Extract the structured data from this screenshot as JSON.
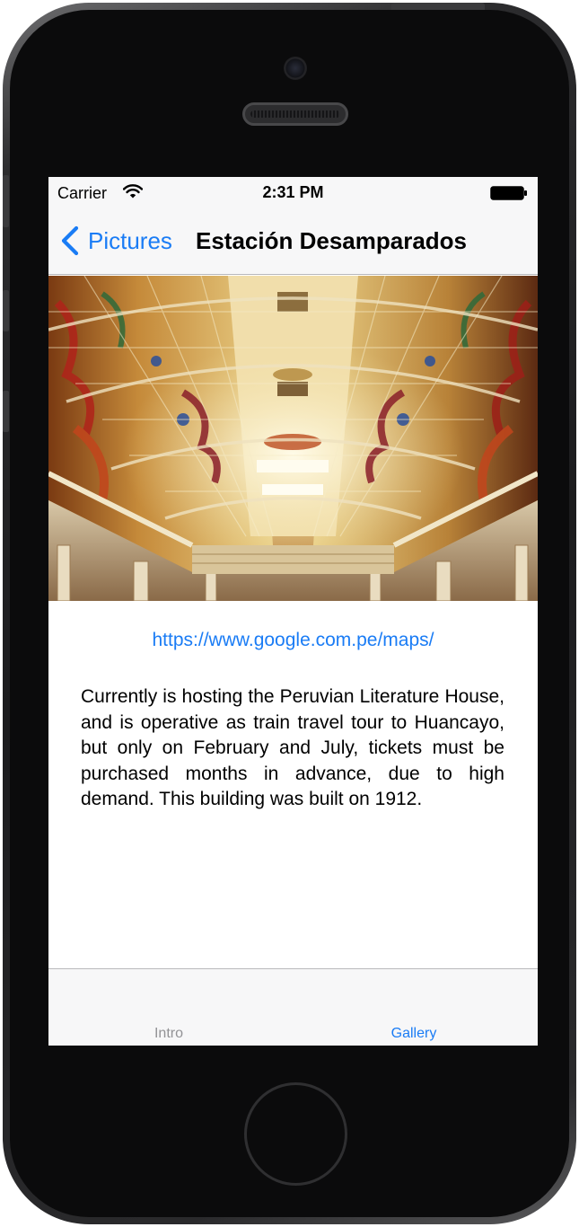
{
  "status_bar": {
    "carrier": "Carrier",
    "time": "2:31 PM",
    "wifi_icon": "wifi-icon",
    "battery_icon": "battery-icon"
  },
  "nav_bar": {
    "back_label": "Pictures",
    "back_icon": "chevron-left-icon",
    "title": "Estación Desamparados"
  },
  "content": {
    "photo_subject": "stained-glass ceiling of Estación Desamparados",
    "link": "https://www.google.com.pe/maps/",
    "description": "Currently is hosting the Peruvian Literature House, and is operative as train travel tour to Huancayo, but only on February and July, tickets must be purchased months in advance, due to high demand. This building was built on 1912."
  },
  "tab_bar": {
    "tabs": [
      {
        "label": "Intro",
        "selected": false
      },
      {
        "label": "Gallery",
        "selected": true
      }
    ]
  },
  "colors": {
    "accent": "#1a7cf5",
    "tab_inactive": "#929295",
    "bar_background": "#f7f7f8"
  }
}
